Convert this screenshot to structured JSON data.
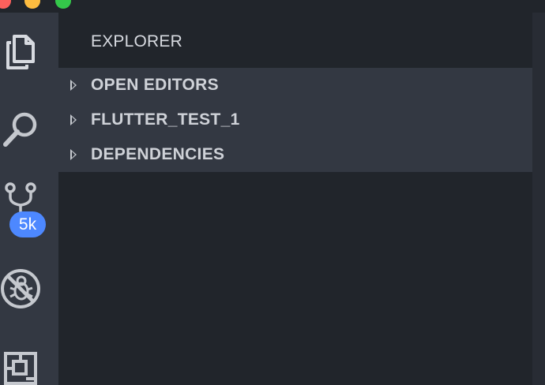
{
  "window": {
    "controls": [
      "close",
      "minimize",
      "zoom"
    ]
  },
  "activity_bar": {
    "items": [
      {
        "name": "explorer",
        "icon": "files-icon"
      },
      {
        "name": "search",
        "icon": "search-icon"
      },
      {
        "name": "source-control",
        "icon": "source-control-icon",
        "badge": "5k"
      },
      {
        "name": "debug",
        "icon": "debug-icon"
      },
      {
        "name": "extensions",
        "icon": "extensions-icon"
      }
    ]
  },
  "sidebar": {
    "title": "EXPLORER",
    "sections": [
      {
        "label": "OPEN EDITORS",
        "collapsed": true
      },
      {
        "label": "FLUTTER_TEST_1",
        "collapsed": true
      },
      {
        "label": "DEPENDENCIES",
        "collapsed": true
      }
    ]
  },
  "colors": {
    "activity_bar": "#333842",
    "sidebar": "#21252b",
    "section_header": "#333842",
    "badge": "#4d88ff",
    "text": "#d7dae0"
  }
}
